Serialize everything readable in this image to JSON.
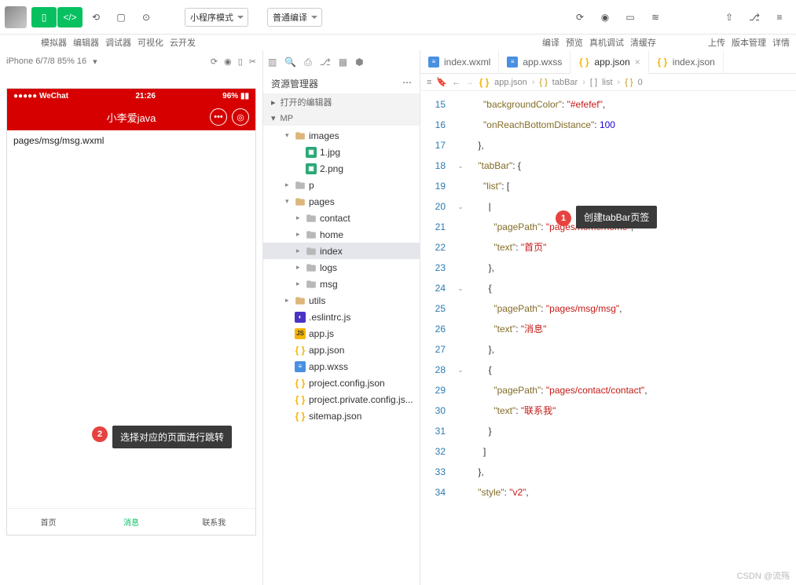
{
  "topbar": {
    "labels": [
      "模拟器",
      "编辑器",
      "调试器",
      "可视化",
      "云开发"
    ],
    "mode_select": "小程序模式",
    "compile_select": "普通编译",
    "right_labels": [
      "编译",
      "预览",
      "真机调试",
      "清缓存"
    ],
    "far_right": [
      "上传",
      "版本管理",
      "详情"
    ]
  },
  "sim": {
    "device": "iPhone 6/7/8 85% 16",
    "status_left": "●●●●● WeChat",
    "status_time": "21:26",
    "status_right": "96%",
    "title": "小李爱java",
    "content": "pages/msg/msg.wxml",
    "tabs": [
      "首页",
      "消息",
      "联系我"
    ],
    "active_tab": 1
  },
  "annotations": {
    "b1": "1",
    "t1": "创建tabBar页签",
    "b2": "2",
    "t2": "选择对应的页面进行跳转"
  },
  "explorer": {
    "title": "资源管理器",
    "sec1": "打开的编辑器",
    "sec2": "MP",
    "tree": [
      {
        "d": 1,
        "c": "▾",
        "i": "folder",
        "open": true,
        "n": "images"
      },
      {
        "d": 2,
        "c": "",
        "i": "img",
        "n": "1.jpg"
      },
      {
        "d": 2,
        "c": "",
        "i": "img",
        "n": "2.png"
      },
      {
        "d": 1,
        "c": "▸",
        "i": "folder",
        "n": "p"
      },
      {
        "d": 1,
        "c": "▾",
        "i": "folder",
        "open": true,
        "n": "pages"
      },
      {
        "d": 2,
        "c": "▸",
        "i": "folder",
        "n": "contact"
      },
      {
        "d": 2,
        "c": "▸",
        "i": "folder",
        "n": "home"
      },
      {
        "d": 2,
        "c": "▸",
        "i": "folder",
        "n": "index",
        "sel": true
      },
      {
        "d": 2,
        "c": "▸",
        "i": "folder",
        "n": "logs"
      },
      {
        "d": 2,
        "c": "▸",
        "i": "folder",
        "n": "msg"
      },
      {
        "d": 1,
        "c": "▸",
        "i": "folder",
        "open": true,
        "n": "utils"
      },
      {
        "d": 1,
        "c": "",
        "i": "eslint",
        "n": ".eslintrc.js"
      },
      {
        "d": 1,
        "c": "",
        "i": "js",
        "n": "app.js"
      },
      {
        "d": 1,
        "c": "",
        "i": "json",
        "n": "app.json"
      },
      {
        "d": 1,
        "c": "",
        "i": "wxss",
        "n": "app.wxss"
      },
      {
        "d": 1,
        "c": "",
        "i": "json",
        "n": "project.config.json"
      },
      {
        "d": 1,
        "c": "",
        "i": "json",
        "n": "project.private.config.js..."
      },
      {
        "d": 1,
        "c": "",
        "i": "json",
        "n": "sitemap.json"
      }
    ]
  },
  "tabs": [
    {
      "icon": "wxss",
      "label": "index.wxml"
    },
    {
      "icon": "wxss",
      "label": "app.wxss"
    },
    {
      "icon": "json",
      "label": "app.json",
      "active": true,
      "close": true
    },
    {
      "icon": "json",
      "label": "index.json"
    }
  ],
  "breadcrumb": [
    "app.json",
    "tabBar",
    "list",
    "0"
  ],
  "code": [
    {
      "n": 15,
      "t": "      \"backgroundColor\": \"#efefef\","
    },
    {
      "n": 16,
      "t": "      \"onReachBottomDistance\": 100"
    },
    {
      "n": 17,
      "t": "    },"
    },
    {
      "n": 18,
      "t": "    \"tabBar\": {",
      "f": "v"
    },
    {
      "n": 19,
      "t": "      \"list\": ["
    },
    {
      "n": 20,
      "t": "        |",
      "f": "v"
    },
    {
      "n": 21,
      "t": "          \"pagePath\": \"pages/home/home\","
    },
    {
      "n": 22,
      "t": "          \"text\": \"首页\""
    },
    {
      "n": 23,
      "t": "        },"
    },
    {
      "n": 24,
      "t": "        {",
      "f": "v"
    },
    {
      "n": 25,
      "t": "          \"pagePath\": \"pages/msg/msg\","
    },
    {
      "n": 26,
      "t": "          \"text\": \"消息\""
    },
    {
      "n": 27,
      "t": "        },"
    },
    {
      "n": 28,
      "t": "        {",
      "f": "v"
    },
    {
      "n": 29,
      "t": "          \"pagePath\": \"pages/contact/contact\","
    },
    {
      "n": 30,
      "t": "          \"text\": \"联系我\""
    },
    {
      "n": 31,
      "t": "        }"
    },
    {
      "n": 32,
      "t": "      ]"
    },
    {
      "n": 33,
      "t": "    },"
    },
    {
      "n": 34,
      "t": "    \"style\": \"v2\","
    }
  ],
  "chart_data": {
    "type": "table",
    "title": "app.json tabBar.list",
    "series": [
      {
        "pagePath": "pages/home/home",
        "text": "首页"
      },
      {
        "pagePath": "pages/msg/msg",
        "text": "消息"
      },
      {
        "pagePath": "pages/contact/contact",
        "text": "联系我"
      }
    ],
    "backgroundColor": "#efefef",
    "onReachBottomDistance": 100,
    "style": "v2"
  },
  "watermark": "CSDN @流殇"
}
